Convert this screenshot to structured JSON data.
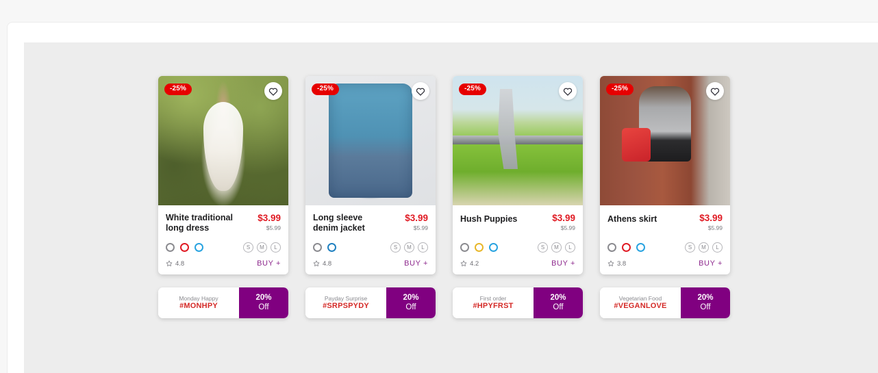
{
  "theme": {
    "page_background": "#f7f7f7",
    "panel_background": "#ffffff",
    "stage_background": "#ededed",
    "discount_badge_color": "#e60000",
    "price_color": "#e01b24",
    "buy_color": "#8e2a8e",
    "coupon_purple": "#800080",
    "coupon_code_color": "#d42a27"
  },
  "icons": {
    "favorite": "heart-icon",
    "rating": "star-icon"
  },
  "labels": {
    "buy": "BUY +",
    "percent_off_value": "20%",
    "percent_off_word": "Off"
  },
  "products": [
    {
      "id": "white-traditional-long-dress",
      "title": "White traditional long dress",
      "discount_badge": "-25%",
      "price_now": "$3.99",
      "price_was": "$5.99",
      "rating": "4.8",
      "buy_label": "BUY +",
      "colors": [
        {
          "name": "gray",
          "hex": "#8b8b90"
        },
        {
          "name": "red",
          "hex": "#e01b24"
        },
        {
          "name": "blue",
          "hex": "#29a3e0"
        }
      ],
      "sizes": [
        "S",
        "M",
        "L"
      ],
      "coupon": {
        "caption": "Monday Happy",
        "code": "#MONHPY",
        "percent": "20%",
        "word": "Off"
      }
    },
    {
      "id": "long-sleeve-denim-jacket",
      "title": "Long sleeve denim jacket",
      "discount_badge": "-25%",
      "price_now": "$3.99",
      "price_was": "$5.99",
      "rating": "4.8",
      "buy_label": "BUY +",
      "colors": [
        {
          "name": "gray",
          "hex": "#8b8b90"
        },
        {
          "name": "blue",
          "hex": "#1f80c0"
        }
      ],
      "sizes": [
        "S",
        "M",
        "L"
      ],
      "coupon": {
        "caption": "Payday Surprise",
        "code": "#SRPSPYDY",
        "percent": "20%",
        "word": "Off"
      }
    },
    {
      "id": "hush-puppies",
      "title": "Hush Puppies",
      "discount_badge": "-25%",
      "price_now": "$3.99",
      "price_was": "$5.99",
      "rating": "4.2",
      "buy_label": "BUY +",
      "colors": [
        {
          "name": "gray",
          "hex": "#8b8b90"
        },
        {
          "name": "yellow",
          "hex": "#e8b72a"
        },
        {
          "name": "blue",
          "hex": "#29a3e0"
        }
      ],
      "sizes": [
        "S",
        "M",
        "L"
      ],
      "coupon": {
        "caption": "First order",
        "code": "#HPYFRST",
        "percent": "20%",
        "word": "Off"
      }
    },
    {
      "id": "athens-skirt",
      "title": "Athens skirt",
      "discount_badge": "-25%",
      "price_now": "$3.99",
      "price_was": "$5.99",
      "rating": "3.8",
      "buy_label": "BUY +",
      "colors": [
        {
          "name": "gray",
          "hex": "#8b8b90"
        },
        {
          "name": "red",
          "hex": "#e01b24"
        },
        {
          "name": "blue",
          "hex": "#29a3e0"
        }
      ],
      "sizes": [
        "S",
        "M",
        "L"
      ],
      "coupon": {
        "caption": "Vegetarian Food",
        "code": "#VEGANLOVE",
        "percent": "20%",
        "word": "Off"
      }
    }
  ]
}
